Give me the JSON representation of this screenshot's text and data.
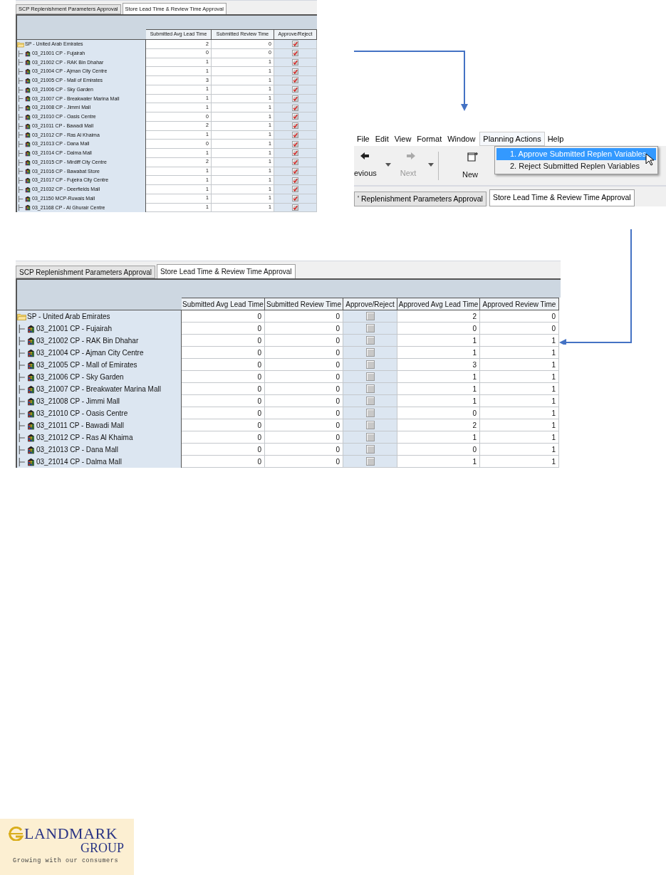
{
  "grid_before": {
    "tabs": [
      {
        "label": "SCP Replenishment Parameters Approval",
        "selected": false
      },
      {
        "label": "Store Lead Time & Review Time Approval",
        "selected": true
      }
    ],
    "columns": [
      "Submitted Avg Lead Time",
      "Submitted Review Time",
      "Approve/Reject"
    ],
    "rows": [
      {
        "label": "SP - United Arab Emirates",
        "kind": "folder",
        "cells": [
          {
            "kind": "number",
            "text": "2"
          },
          {
            "kind": "number",
            "text": "0"
          },
          {
            "kind": "check",
            "checked": true
          }
        ],
        "children": [
          {
            "label": "03_21001 CP - Fujairah",
            "kind": "store",
            "cells": [
              {
                "kind": "number",
                "text": "0"
              },
              {
                "kind": "number",
                "text": "0"
              },
              {
                "kind": "check",
                "checked": true
              }
            ]
          },
          {
            "label": "03_21002 CP - RAK Bin Dhahar",
            "kind": "store",
            "cells": [
              {
                "kind": "number",
                "text": "1"
              },
              {
                "kind": "number",
                "text": "1"
              },
              {
                "kind": "check",
                "checked": true
              }
            ]
          },
          {
            "label": "03_21004 CP - Ajman City Centre",
            "kind": "store",
            "cells": [
              {
                "kind": "number",
                "text": "1"
              },
              {
                "kind": "number",
                "text": "1"
              },
              {
                "kind": "check",
                "checked": true
              }
            ]
          },
          {
            "label": "03_21005 CP - Mall of Emirates",
            "kind": "store",
            "cells": [
              {
                "kind": "number",
                "text": "3"
              },
              {
                "kind": "number",
                "text": "1"
              },
              {
                "kind": "check",
                "checked": true
              }
            ]
          },
          {
            "label": "03_21006 CP - Sky Garden",
            "kind": "store",
            "cells": [
              {
                "kind": "number",
                "text": "1"
              },
              {
                "kind": "number",
                "text": "1"
              },
              {
                "kind": "check",
                "checked": true
              }
            ]
          },
          {
            "label": "03_21007 CP - Breakwater Marina Mall",
            "kind": "store",
            "cells": [
              {
                "kind": "number",
                "text": "1"
              },
              {
                "kind": "number",
                "text": "1"
              },
              {
                "kind": "check",
                "checked": true
              }
            ]
          },
          {
            "label": "03_21008 CP - Jimmi Mall",
            "kind": "store",
            "cells": [
              {
                "kind": "number",
                "text": "1"
              },
              {
                "kind": "number",
                "text": "1"
              },
              {
                "kind": "check",
                "checked": true
              }
            ]
          },
          {
            "label": "03_21010 CP - Oasis Centre",
            "kind": "store",
            "cells": [
              {
                "kind": "number",
                "text": "0"
              },
              {
                "kind": "number",
                "text": "1"
              },
              {
                "kind": "check",
                "checked": true
              }
            ]
          },
          {
            "label": "03_21011 CP - Bawadi Mall",
            "kind": "store",
            "cells": [
              {
                "kind": "number",
                "text": "2"
              },
              {
                "kind": "number",
                "text": "1"
              },
              {
                "kind": "check",
                "checked": true
              }
            ]
          },
          {
            "label": "03_21012 CP - Ras Al Khaima",
            "kind": "store",
            "cells": [
              {
                "kind": "number",
                "text": "1"
              },
              {
                "kind": "number",
                "text": "1"
              },
              {
                "kind": "check",
                "checked": true
              }
            ]
          },
          {
            "label": "03_21013 CP - Dana Mall",
            "kind": "store",
            "cells": [
              {
                "kind": "number",
                "text": "0"
              },
              {
                "kind": "number",
                "text": "1"
              },
              {
                "kind": "check",
                "checked": true
              }
            ]
          },
          {
            "label": "03_21014 CP - Dalma Mall",
            "kind": "store",
            "cells": [
              {
                "kind": "number",
                "text": "1"
              },
              {
                "kind": "number",
                "text": "1"
              },
              {
                "kind": "check",
                "checked": true
              }
            ]
          },
          {
            "label": "03_21015 CP - Mirdiff City Centre",
            "kind": "store",
            "cells": [
              {
                "kind": "number",
                "text": "2"
              },
              {
                "kind": "number",
                "text": "1"
              },
              {
                "kind": "check",
                "checked": true
              }
            ]
          },
          {
            "label": "03_21016 CP - Bawabat  Store",
            "kind": "store",
            "cells": [
              {
                "kind": "number",
                "text": "1"
              },
              {
                "kind": "number",
                "text": "1"
              },
              {
                "kind": "check",
                "checked": true
              }
            ]
          },
          {
            "label": "03_21017 CP - Fujeira City Centre",
            "kind": "store",
            "cells": [
              {
                "kind": "number",
                "text": "1"
              },
              {
                "kind": "number",
                "text": "1"
              },
              {
                "kind": "check",
                "checked": true
              }
            ]
          },
          {
            "label": "03_21032 CP - Deerfields Mall",
            "kind": "store",
            "cells": [
              {
                "kind": "number",
                "text": "1"
              },
              {
                "kind": "number",
                "text": "1"
              },
              {
                "kind": "check",
                "checked": true
              }
            ]
          },
          {
            "label": "03_21150 MCP-Ruwais Mall",
            "kind": "store",
            "cells": [
              {
                "kind": "number",
                "text": "1"
              },
              {
                "kind": "number",
                "text": "1"
              },
              {
                "kind": "check",
                "checked": true
              }
            ]
          },
          {
            "label": "03_21168 CP - Al Ghurair Centre",
            "kind": "store",
            "cells": [
              {
                "kind": "number",
                "text": "1"
              },
              {
                "kind": "number",
                "text": "1"
              },
              {
                "kind": "check",
                "checked": true
              }
            ]
          }
        ]
      }
    ]
  },
  "menu_window": {
    "menu_bar": [
      {
        "label": "File",
        "open": false
      },
      {
        "label": "Edit",
        "open": false
      },
      {
        "label": "View",
        "open": false
      },
      {
        "label": "Format",
        "open": false
      },
      {
        "label": "Window",
        "open": false
      },
      {
        "label": "Planning Actions",
        "open": true
      },
      {
        "label": "Help",
        "open": false
      }
    ],
    "toolbar": [
      {
        "label": "evious",
        "kind": "back",
        "disabled": false
      },
      {
        "label": "Next",
        "kind": "forward",
        "disabled": true
      },
      {
        "label": "New",
        "kind": "new",
        "disabled": false
      }
    ],
    "menu_items": [
      {
        "label": "1. Approve Submitted Replen Variables",
        "selected": true
      },
      {
        "label": "2. Reject Submitted Replen Variables",
        "selected": false
      }
    ],
    "tabs": [
      {
        "label": "' Replenishment Parameters Approval",
        "selected": false
      },
      {
        "label": "Store Lead Time & Review Time Approval",
        "selected": true
      }
    ]
  },
  "grid_after": {
    "tabs": [
      {
        "label": "SCP Replenishment Parameters Approval",
        "selected": false
      },
      {
        "label": "Store Lead Time & Review Time Approval",
        "selected": true
      }
    ],
    "columns": [
      "Submitted Avg Lead Time",
      "Submitted Review Time",
      "Approve/Reject",
      "Approved Avg Lead Time",
      "Approved Review Time"
    ],
    "rows": [
      {
        "label": "SP - United Arab Emirates",
        "kind": "folder",
        "cells": [
          {
            "kind": "number",
            "text": "0"
          },
          {
            "kind": "number",
            "text": "0"
          },
          {
            "kind": "check",
            "checked": false
          },
          {
            "kind": "number",
            "text": "2"
          },
          {
            "kind": "number",
            "text": "0"
          }
        ],
        "children": [
          {
            "label": "03_21001 CP - Fujairah",
            "kind": "store",
            "cells": [
              {
                "kind": "number",
                "text": "0"
              },
              {
                "kind": "number",
                "text": "0"
              },
              {
                "kind": "check",
                "checked": false
              },
              {
                "kind": "number",
                "text": "0"
              },
              {
                "kind": "number",
                "text": "0"
              }
            ]
          },
          {
            "label": "03_21002 CP - RAK Bin Dhahar",
            "kind": "store",
            "cells": [
              {
                "kind": "number",
                "text": "0"
              },
              {
                "kind": "number",
                "text": "0"
              },
              {
                "kind": "check",
                "checked": false
              },
              {
                "kind": "number",
                "text": "1"
              },
              {
                "kind": "number",
                "text": "1"
              }
            ]
          },
          {
            "label": "03_21004 CP - Ajman City Centre",
            "kind": "store",
            "cells": [
              {
                "kind": "number",
                "text": "0"
              },
              {
                "kind": "number",
                "text": "0"
              },
              {
                "kind": "check",
                "checked": false
              },
              {
                "kind": "number",
                "text": "1"
              },
              {
                "kind": "number",
                "text": "1"
              }
            ]
          },
          {
            "label": "03_21005 CP - Mall of Emirates",
            "kind": "store",
            "cells": [
              {
                "kind": "number",
                "text": "0"
              },
              {
                "kind": "number",
                "text": "0"
              },
              {
                "kind": "check",
                "checked": false
              },
              {
                "kind": "number",
                "text": "3"
              },
              {
                "kind": "number",
                "text": "1"
              }
            ]
          },
          {
            "label": "03_21006 CP - Sky Garden",
            "kind": "store",
            "cells": [
              {
                "kind": "number",
                "text": "0"
              },
              {
                "kind": "number",
                "text": "0"
              },
              {
                "kind": "check",
                "checked": false
              },
              {
                "kind": "number",
                "text": "1"
              },
              {
                "kind": "number",
                "text": "1"
              }
            ]
          },
          {
            "label": "03_21007 CP - Breakwater Marina Mall",
            "kind": "store",
            "cells": [
              {
                "kind": "number",
                "text": "0"
              },
              {
                "kind": "number",
                "text": "0"
              },
              {
                "kind": "check",
                "checked": false
              },
              {
                "kind": "number",
                "text": "1"
              },
              {
                "kind": "number",
                "text": "1"
              }
            ]
          },
          {
            "label": "03_21008 CP - Jimmi Mall",
            "kind": "store",
            "cells": [
              {
                "kind": "number",
                "text": "0"
              },
              {
                "kind": "number",
                "text": "0"
              },
              {
                "kind": "check",
                "checked": false
              },
              {
                "kind": "number",
                "text": "1"
              },
              {
                "kind": "number",
                "text": "1"
              }
            ]
          },
          {
            "label": "03_21010 CP - Oasis Centre",
            "kind": "store",
            "cells": [
              {
                "kind": "number",
                "text": "0"
              },
              {
                "kind": "number",
                "text": "0"
              },
              {
                "kind": "check",
                "checked": false
              },
              {
                "kind": "number",
                "text": "0"
              },
              {
                "kind": "number",
                "text": "1"
              }
            ]
          },
          {
            "label": "03_21011 CP - Bawadi Mall",
            "kind": "store",
            "cells": [
              {
                "kind": "number",
                "text": "0"
              },
              {
                "kind": "number",
                "text": "0"
              },
              {
                "kind": "check",
                "checked": false
              },
              {
                "kind": "number",
                "text": "2"
              },
              {
                "kind": "number",
                "text": "1"
              }
            ]
          },
          {
            "label": "03_21012 CP - Ras Al Khaima",
            "kind": "store",
            "cells": [
              {
                "kind": "number",
                "text": "0"
              },
              {
                "kind": "number",
                "text": "0"
              },
              {
                "kind": "check",
                "checked": false
              },
              {
                "kind": "number",
                "text": "1"
              },
              {
                "kind": "number",
                "text": "1"
              }
            ]
          },
          {
            "label": "03_21013 CP - Dana Mall",
            "kind": "store",
            "cells": [
              {
                "kind": "number",
                "text": "0"
              },
              {
                "kind": "number",
                "text": "0"
              },
              {
                "kind": "check",
                "checked": false
              },
              {
                "kind": "number",
                "text": "0"
              },
              {
                "kind": "number",
                "text": "1"
              }
            ]
          },
          {
            "label": "03_21014 CP - Dalma Mall",
            "kind": "store",
            "cells": [
              {
                "kind": "number",
                "text": "0"
              },
              {
                "kind": "number",
                "text": "0"
              },
              {
                "kind": "check",
                "checked": false
              },
              {
                "kind": "number",
                "text": "1"
              },
              {
                "kind": "number",
                "text": "1"
              }
            ]
          }
        ]
      }
    ]
  },
  "logo": {
    "name": "LANDMARK",
    "sub": "GROUP",
    "tagline": "Growing with our consumers"
  }
}
